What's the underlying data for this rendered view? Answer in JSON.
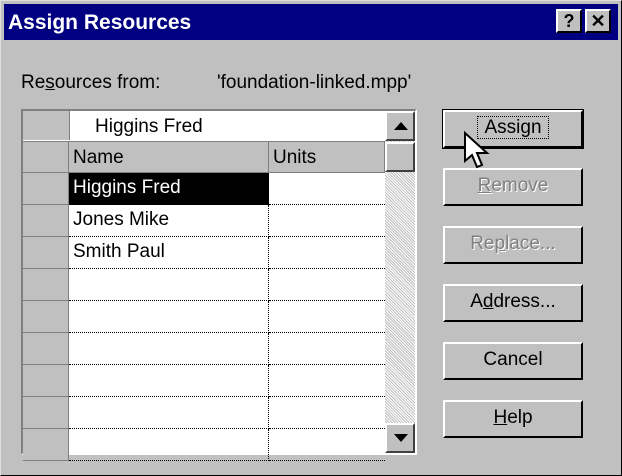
{
  "window": {
    "title": "Assign Resources",
    "help_glyph": "?",
    "close_glyph": "✕"
  },
  "source": {
    "label_pre": "Re",
    "label_ul": "s",
    "label_post": "ources from:",
    "file": "'foundation-linked.mpp'"
  },
  "grid": {
    "edit_value": "Higgins Fred",
    "columns": [
      "Name",
      "Units"
    ],
    "rows": [
      {
        "name": "Higgins Fred",
        "units": ""
      },
      {
        "name": "Jones Mike",
        "units": ""
      },
      {
        "name": "Smith Paul",
        "units": ""
      },
      {
        "name": "",
        "units": ""
      },
      {
        "name": "",
        "units": ""
      },
      {
        "name": "",
        "units": ""
      },
      {
        "name": "",
        "units": ""
      },
      {
        "name": "",
        "units": ""
      },
      {
        "name": "",
        "units": ""
      }
    ]
  },
  "buttons": {
    "assign": "Assign",
    "remove_ul": "R",
    "remove_rest": "emove",
    "replace_pre": "Re",
    "replace_ul": "p",
    "replace_post": "lace...",
    "address_pre": "A",
    "address_ul": "d",
    "address_post": "dress...",
    "cancel": "Cancel",
    "help_ul": "H",
    "help_rest": "elp"
  }
}
